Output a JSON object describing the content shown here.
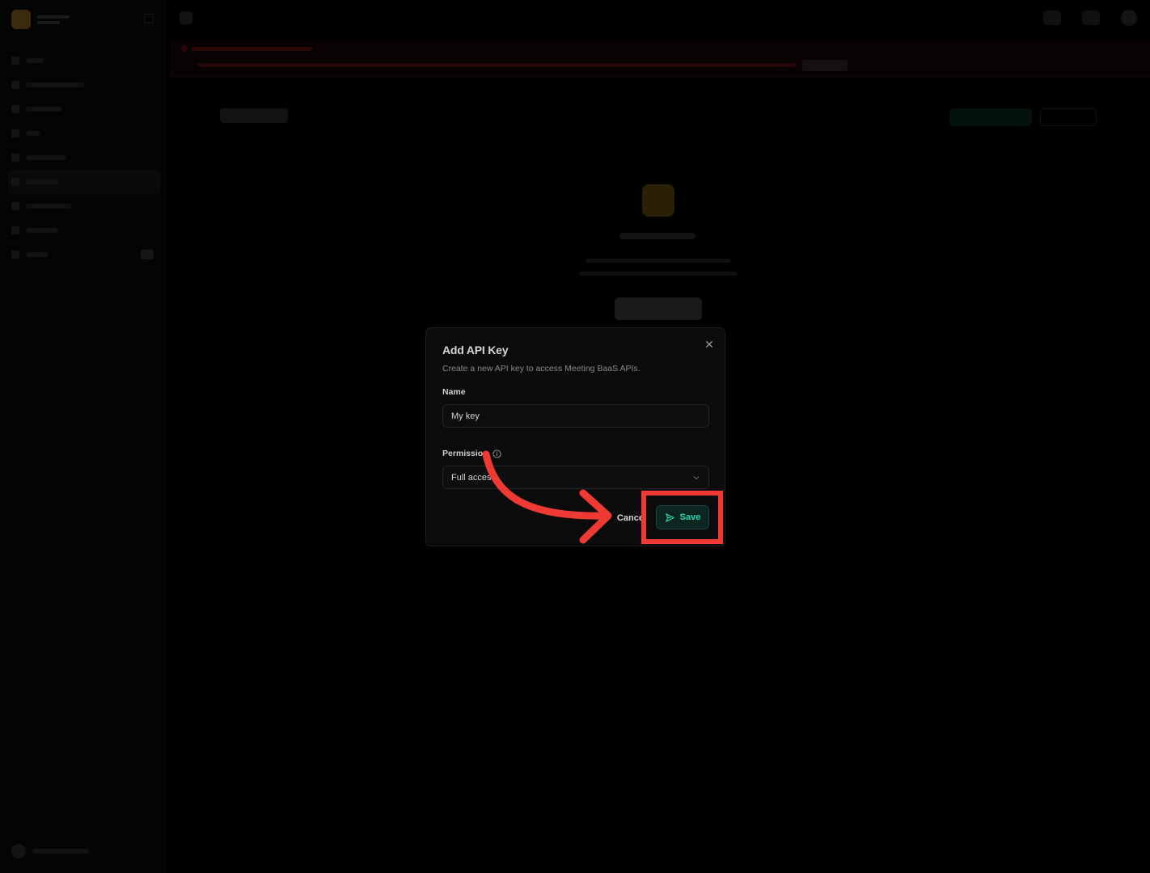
{
  "modal": {
    "title": "Add API Key",
    "description": "Create a new API key to access Meeting BaaS APIs.",
    "name_label": "Name",
    "name_value": "My key",
    "permission_label": "Permission",
    "permission_value": "Full access",
    "cancel_label": "Cancel",
    "save_label": "Save",
    "close_icon": "close-icon",
    "info_icon": "info-icon",
    "send_icon": "send-icon",
    "chevron_icon": "chevron-down-icon"
  },
  "annotation": {
    "highlight_color": "#ef3a33",
    "target": "save-button"
  },
  "colors": {
    "accent": "#2fd6b3",
    "save_bg": "#0b2621",
    "backdrop": "#000000"
  }
}
